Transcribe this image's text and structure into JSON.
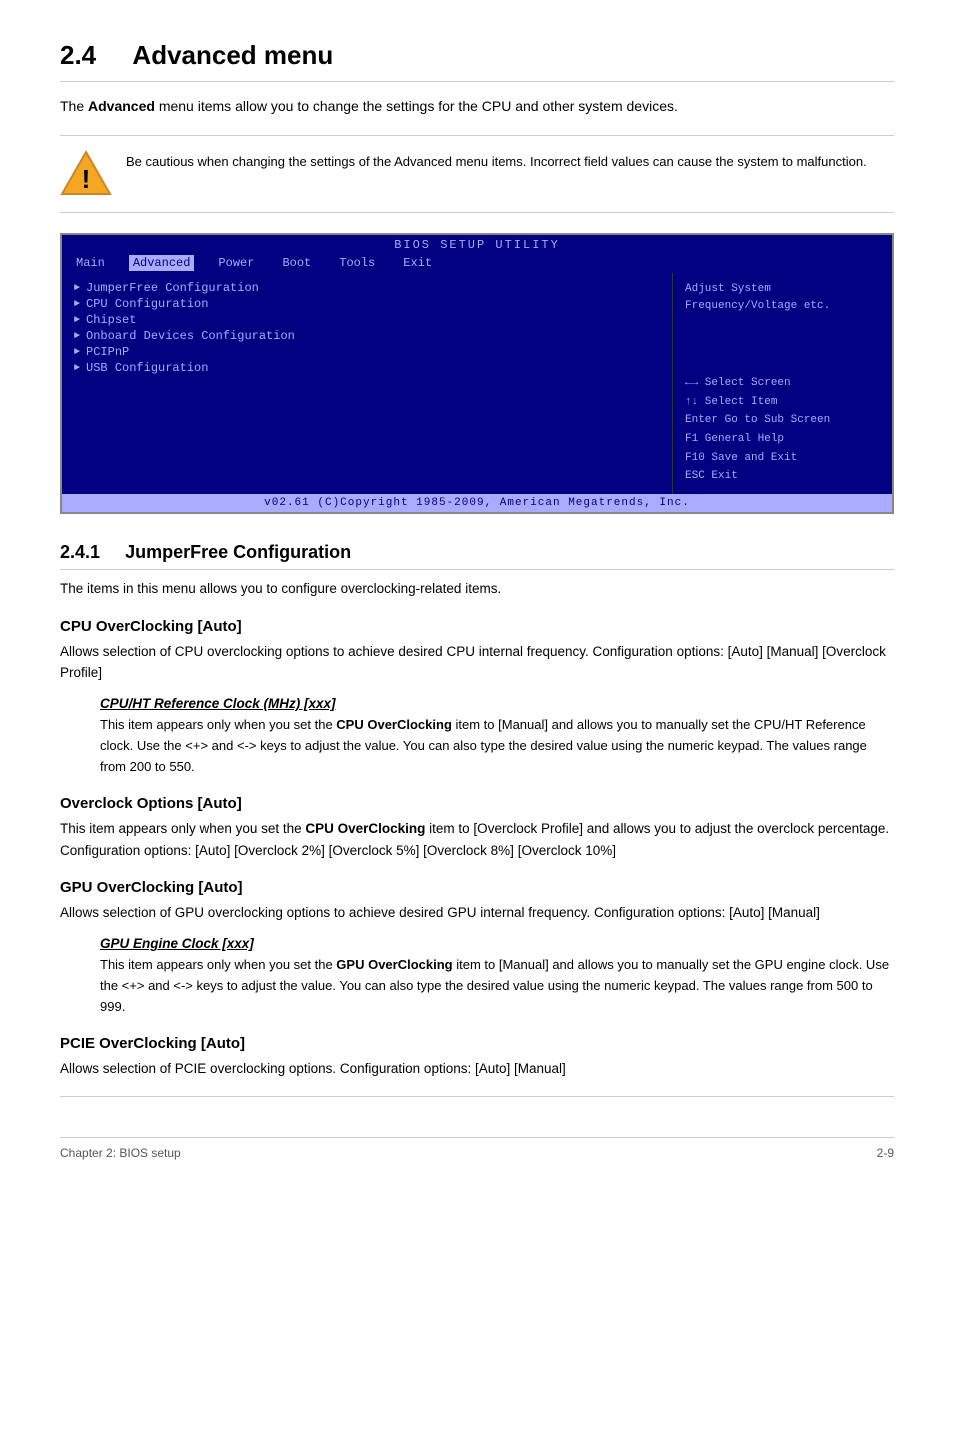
{
  "page": {
    "section_number": "2.4",
    "section_title": "Advanced menu",
    "intro": "The <b>Advanced</b> menu items allow you to change the settings for the CPU and other system devices.",
    "warning_text": "Be cautious when changing the settings of the Advanced menu items. Incorrect field values can cause the system to malfunction."
  },
  "bios": {
    "title": "BIOS SETUP UTILITY",
    "menu_items": [
      "Main",
      "Advanced",
      "Power",
      "Boot",
      "Tools",
      "Exit"
    ],
    "active_menu": "Advanced",
    "entries": [
      "JumperFree Configuration",
      "CPU Configuration",
      "Chipset",
      "Onboard Devices Configuration",
      "PCIPnP",
      "USB Configuration"
    ],
    "help_text": "Adjust System\nFrequency/Voltage etc.",
    "keys": [
      "←→   Select Screen",
      "↑↓   Select Item",
      "Enter Go to Sub Screen",
      "F1   General Help",
      "F10  Save and Exit",
      "ESC  Exit"
    ],
    "footer": "v02.61  (C)Copyright 1985-2009, American Megatrends, Inc."
  },
  "subsection": {
    "number": "2.4.1",
    "title": "JumperFree Configuration",
    "intro": "The items in this menu allows you to configure overclocking-related items."
  },
  "items": [
    {
      "heading": "CPU OverClocking [Auto]",
      "description": "Allows selection of CPU overclocking options to achieve desired CPU internal frequency. Configuration options: [Auto] [Manual] [Overclock Profile]",
      "sub_item": {
        "heading": "CPU/HT Reference Clock (MHz) [xxx]",
        "description": "This item appears only when you set the CPU OverClocking item to [Manual] and allows you to manually set the CPU/HT Reference clock. Use the <+> and <-> keys to adjust the value. You can also type the desired value using the numeric keypad. The values range from 200 to 550."
      }
    },
    {
      "heading": "Overclock Options [Auto]",
      "description": "This item appears only when you set the CPU OverClocking item to [Overclock Profile] and allows you to adjust the overclock percentage.\nConfiguration options: [Auto] [Overclock 2%] [Overclock 5%] [Overclock 8%] [Overclock 10%]",
      "sub_item": null
    },
    {
      "heading": "GPU OverClocking [Auto]",
      "description": "Allows selection of GPU overclocking options to achieve desired GPU internal frequency. Configuration options: [Auto] [Manual]",
      "sub_item": {
        "heading": "GPU Engine Clock [xxx]",
        "description": "This item appears only when you set the GPU OverClocking item to [Manual] and allows you to manually set the GPU engine clock. Use the <+> and <-> keys to adjust the value. You can also type the desired value using the numeric keypad. The values range from 500 to 999."
      }
    },
    {
      "heading": "PCIE OverClocking [Auto]",
      "description": "Allows selection of PCIE overclocking options. Configuration options: [Auto] [Manual]",
      "sub_item": null
    }
  ],
  "footer": {
    "left": "Chapter 2: BIOS setup",
    "right": "2-9"
  }
}
